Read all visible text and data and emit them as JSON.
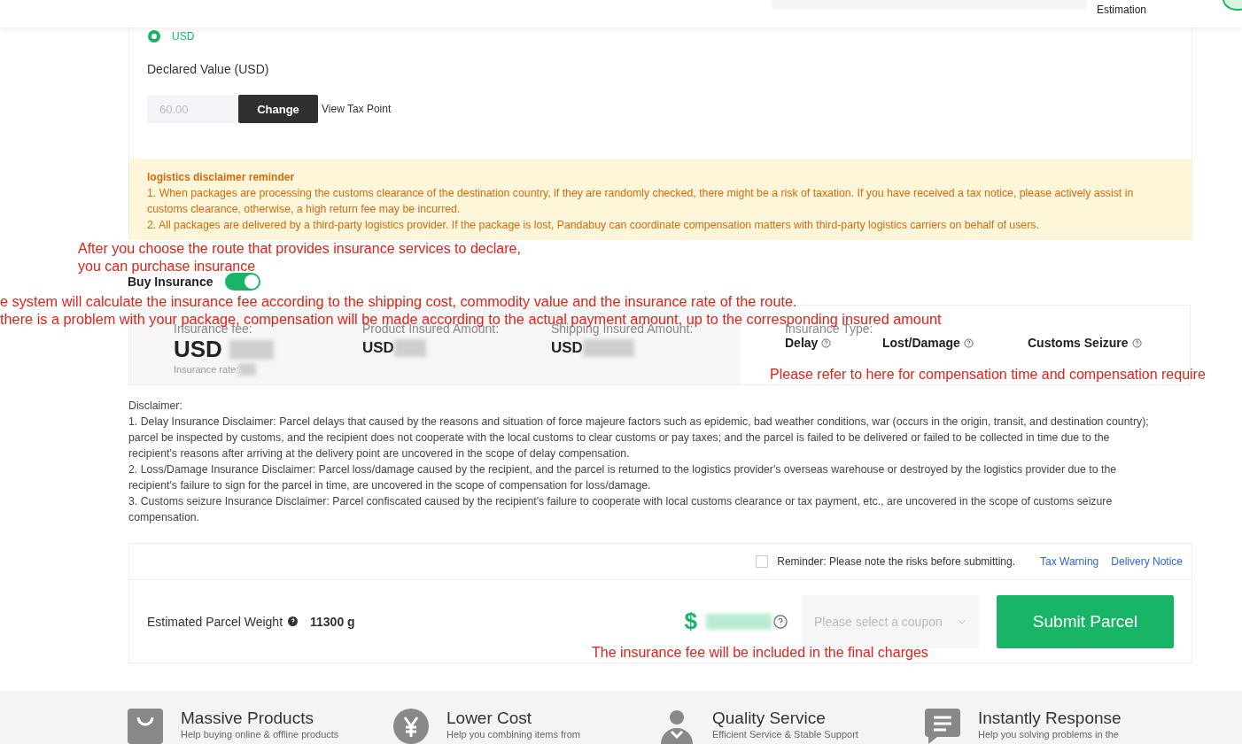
{
  "header": {
    "estimation": "Estimation"
  },
  "currency": {
    "label": "USD",
    "selected": true
  },
  "declared": {
    "label": "Declared Value (USD)",
    "value": "60.00",
    "button": "Change",
    "link": "View Tax Point"
  },
  "reminder_box": {
    "title": "logistics disclaimer reminder",
    "lines": [
      "1. When packages are processing the customs clearance of the destination country, if they are randomly checked, there might be a risk of taxation. If you have received a tax notice, please actively assist in customs clearance, otherwise, a high return fee may be incurred.",
      "2. All packages are delivered by a third-party logistics provider. If the package is lost, Pandabuy can coordinate compensation matters with third-party logistics carriers on behalf of users."
    ]
  },
  "insurance": {
    "label": "Buy Insurance",
    "on": true,
    "fee_label": "Insurance fee:",
    "fee_currency": "USD",
    "rate_label": "Insurance rate:",
    "product_label": "Product Insured Amount:",
    "product_currency": "USD",
    "shipping_label": "Shipping Insured Amount:",
    "shipping_currency": "USD",
    "type_label": "Insurance Type:",
    "types": [
      {
        "name": "Delay"
      },
      {
        "name": "Lost/Damage"
      },
      {
        "name": "Customs Seizure"
      }
    ]
  },
  "disclaimer": {
    "title": "Disclaimer:",
    "lines": [
      "1. Delay Insurance Disclaimer: Parcel delays that caused by the reasons and situation of force majeure factors such as epidemic, bad weather conditions, war (occurs in the origin, transit, and destination country); parcel be inspected by customs, and the recipient does not cooperate with the local customs to clear customs or pay taxes; and the parcel is failed to be delivered or failed to be collected in time due to the recipient's reasons after arriving at the delivery point are uncovered in the scope of delay compensation.",
      "2. Loss/Damage Insurance Disclaimer: Parcel loss/damage caused by the recipient, and the parcel is returned to the logistics provider's overseas warehouse or destroyed by the logistics provider due to the recipient's failure to sign for the parcel in time, are uncovered in the scope of compensation for loss/damage.",
      "3. Customs seizure Insurance Disclaimer: Parcel confiscated caused by the recipient's failure to cooperate with local customs clearance or tax payment, etc., are uncovered in the scope of customs seizure compensation."
    ]
  },
  "submit": {
    "reminder": "Reminder: Please note the risks before submitting.",
    "reminder_checked": false,
    "links": [
      "Tax Warning",
      "Delivery Notice"
    ],
    "weight_label": "Estimated Parcel Weight",
    "weight": "11300 g",
    "currency_sign": "$",
    "coupon_placeholder": "Please select a coupon",
    "button": "Submit Parcel"
  },
  "annotations": [
    {
      "lines": [
        "After you choose the route that provides insurance services to declare,",
        "you can purchase insurance"
      ]
    },
    {
      "lines": [
        "e system will calculate the insurance fee according to the shipping cost, commodity value and the insurance rate of the route.",
        "there is a problem with your package, compensation will be made according to the actual payment amount, up to the corresponding insured amount"
      ]
    },
    {
      "lines": [
        "Please refer to here for compensation time and compensation require"
      ]
    },
    {
      "lines": [
        "The insurance fee will be included in the final charges"
      ]
    }
  ],
  "features": [
    {
      "title": "Massive Products",
      "subtitle": "Help buying online & offline products",
      "kind": "bag"
    },
    {
      "title": "Lower Cost",
      "subtitle": "Help you combining items from",
      "kind": "yen"
    },
    {
      "title": "Quality Service",
      "subtitle": "Efficient Service & Stable Support",
      "kind": "person"
    },
    {
      "title": "Instantly Response",
      "subtitle": "Help you solving problems in the",
      "kind": "chat"
    }
  ]
}
